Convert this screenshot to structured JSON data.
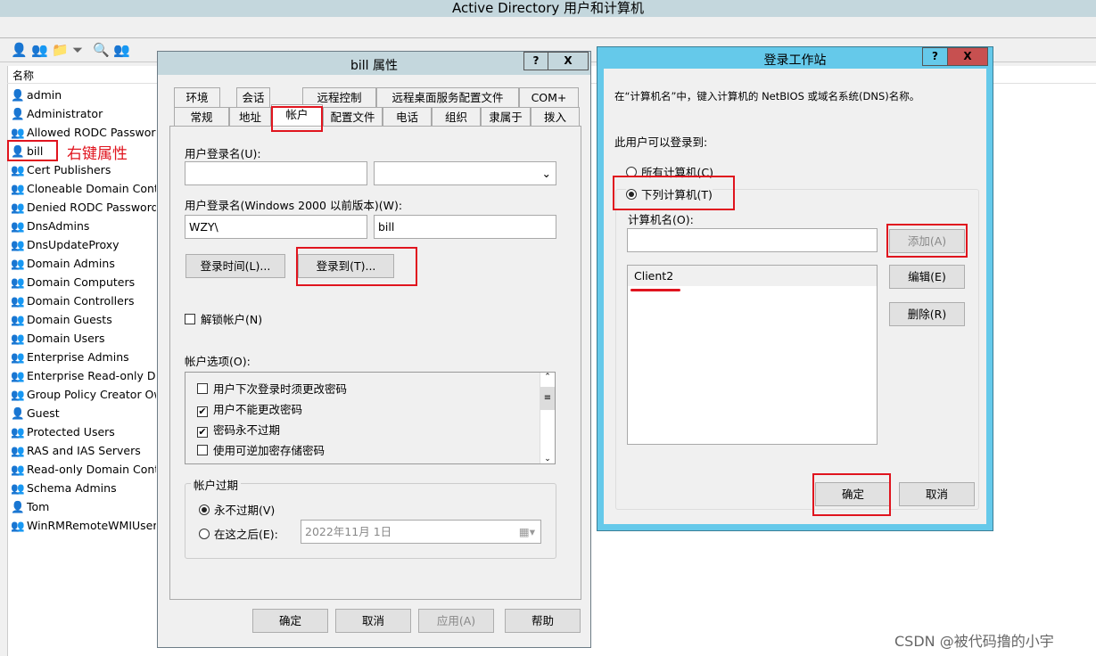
{
  "app": {
    "title": "Active Directory 用户和计算机"
  },
  "toolbar": {
    "icons": [
      "new-user-icon",
      "new-group-icon",
      "new-ou-icon",
      "filter-icon",
      "find-icon",
      "add-to-group-icon"
    ]
  },
  "list": {
    "header": "名称",
    "items": [
      {
        "name": "admin",
        "type": "user"
      },
      {
        "name": "Administrator",
        "type": "user"
      },
      {
        "name": "Allowed RODC Password",
        "type": "group"
      },
      {
        "name": "bill",
        "type": "user"
      },
      {
        "name": "Cert Publishers",
        "type": "group"
      },
      {
        "name": "Cloneable Domain Contr",
        "type": "group"
      },
      {
        "name": "Denied RODC Password",
        "type": "group"
      },
      {
        "name": "DnsAdmins",
        "type": "group"
      },
      {
        "name": "DnsUpdateProxy",
        "type": "group"
      },
      {
        "name": "Domain Admins",
        "type": "group"
      },
      {
        "name": "Domain Computers",
        "type": "group"
      },
      {
        "name": "Domain Controllers",
        "type": "group"
      },
      {
        "name": "Domain Guests",
        "type": "group"
      },
      {
        "name": "Domain Users",
        "type": "group"
      },
      {
        "name": "Enterprise Admins",
        "type": "group"
      },
      {
        "name": "Enterprise Read-only Do",
        "type": "group"
      },
      {
        "name": "Group Policy Creator Ow",
        "type": "group"
      },
      {
        "name": "Guest",
        "type": "user"
      },
      {
        "name": "Protected Users",
        "type": "group"
      },
      {
        "name": "RAS and IAS Servers",
        "type": "group"
      },
      {
        "name": "Read-only Domain Contr",
        "type": "group"
      },
      {
        "name": "Schema Admins",
        "type": "group"
      },
      {
        "name": "Tom",
        "type": "user"
      },
      {
        "name": "WinRMRemoteWMIUsers",
        "type": "group"
      }
    ],
    "annotation": "右键属性"
  },
  "props": {
    "title": "bill 属性",
    "help": "?",
    "close": "X",
    "tabs_row1": [
      "环境",
      "会话",
      "远程控制",
      "远程桌面服务配置文件",
      "COM+"
    ],
    "tabs_row2": [
      "常规",
      "地址",
      "帐户",
      "配置文件",
      "电话",
      "组织",
      "隶属于",
      "拨入"
    ],
    "active_tab": "帐户",
    "logon_name_label": "用户登录名(U):",
    "logon_name": "",
    "upn_suffix": "",
    "pre2000_label": "用户登录名(Windows 2000 以前版本)(W):",
    "domain": "WZY\\",
    "sam": "bill",
    "logon_hours": "登录时间(L)...",
    "logon_to": "登录到(T)...",
    "unlock": {
      "label": "解锁帐户(N)",
      "checked": false
    },
    "options_label": "帐户选项(O):",
    "options": [
      {
        "label": "用户下次登录时须更改密码",
        "checked": false
      },
      {
        "label": "用户不能更改密码",
        "checked": true
      },
      {
        "label": "密码永不过期",
        "checked": true
      },
      {
        "label": "使用可逆加密存储密码",
        "checked": false
      }
    ],
    "expiry_label": "帐户过期",
    "never": "永不过期(V)",
    "after": "在这之后(E):",
    "expiry_selected": "never",
    "date": "2022年11月  1日",
    "ok": "确定",
    "cancel": "取消",
    "apply": "应用(A)",
    "help_btn": "帮助"
  },
  "logon": {
    "title": "登录工作站",
    "help": "?",
    "close": "X",
    "desc": "在“计算机名”中，键入计算机的 NetBIOS 或域名系统(DNS)名称。",
    "can_logon": "此用户可以登录到:",
    "all": "所有计算机(C)",
    "following": "下列计算机(T)",
    "selected": "following",
    "computer_label": "计算机名(O):",
    "computer_input": "",
    "computers": [
      "Client2"
    ],
    "add": "添加(A)",
    "edit": "编辑(E)",
    "remove": "删除(R)",
    "ok": "确定",
    "cancel": "取消"
  },
  "colors": {
    "active_title": "#65c9ea",
    "inactive_title": "#c4d7dd",
    "close_red": "#c75050",
    "annotation_red": "#e0141e"
  },
  "watermark": "CSDN @被代码撸的小宇"
}
